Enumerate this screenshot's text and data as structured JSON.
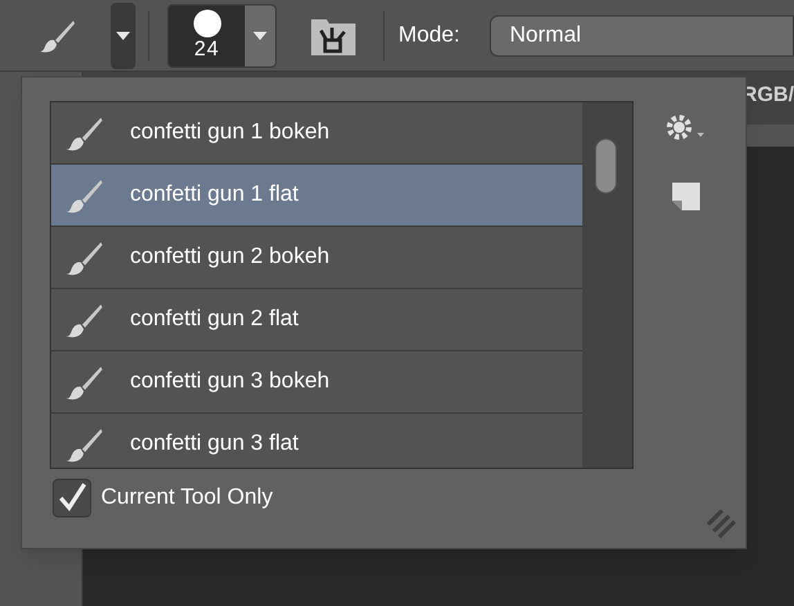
{
  "toolbar": {
    "brush_size": "24",
    "mode_label": "Mode:",
    "mode_value": "Normal"
  },
  "document": {
    "tab_text": "RGB/"
  },
  "brush_presets": {
    "items": [
      {
        "name": "confetti gun 1 bokeh",
        "selected": false
      },
      {
        "name": "confetti gun 1 flat",
        "selected": true
      },
      {
        "name": "confetti gun 2 bokeh",
        "selected": false
      },
      {
        "name": "confetti gun 2 flat",
        "selected": false
      },
      {
        "name": "confetti gun 3 bokeh",
        "selected": false
      },
      {
        "name": "confetti gun 3 flat",
        "selected": false
      }
    ],
    "current_tool_only": {
      "label": "Current Tool Only",
      "checked": true
    }
  }
}
